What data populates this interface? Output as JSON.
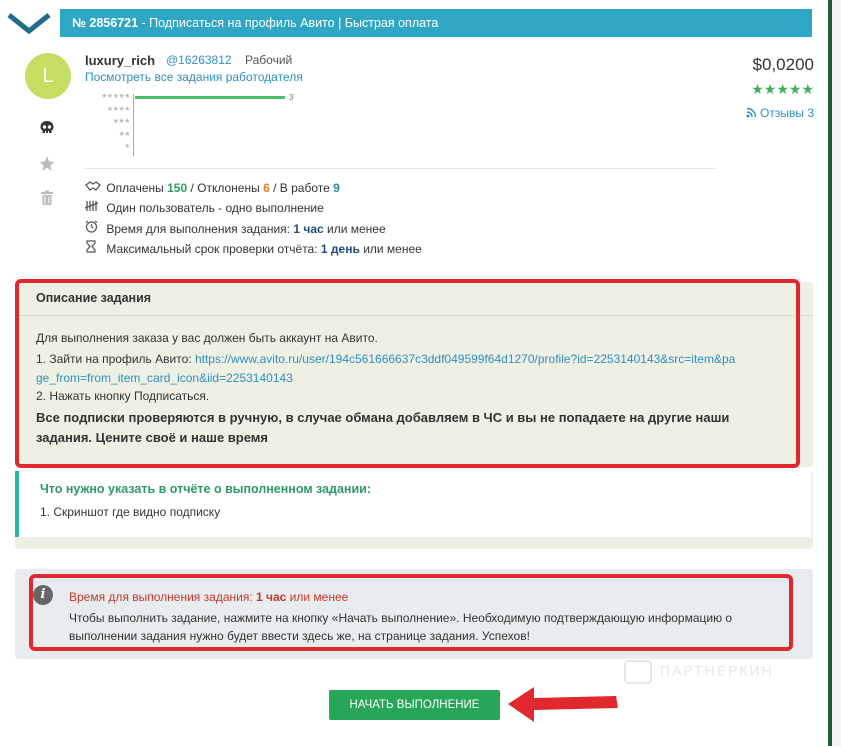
{
  "header": {
    "task_number": "№ 2856721",
    "title": " - Подписаться на профиль Авито | Быстрая оплата"
  },
  "employer": {
    "avatar_letter": "L",
    "avatar_color": "#c5df63",
    "name": "luxury_rich",
    "id": "@16263812",
    "status": "Рабочий",
    "view_tasks_link": "Посмотреть все задания работодателя",
    "side_icons": [
      "skull-icon",
      "star-icon",
      "trash-icon"
    ],
    "rating_distribution": [
      {
        "stars": "★★★★★",
        "count": 3,
        "count_label": "3"
      },
      {
        "stars": "★★★★",
        "count": 0
      },
      {
        "stars": "★★★",
        "count": 0
      },
      {
        "stars": "★★",
        "count": 0
      },
      {
        "stars": "★",
        "count": 0
      }
    ]
  },
  "price": {
    "amount": "$0,0200",
    "stars": "★★★★★",
    "reviews_label": "Отзывы 3",
    "accent": "#3cb05a"
  },
  "stats": {
    "paid_label": "Оплачены",
    "paid": "150",
    "sep1": " / ",
    "rejected_label": "Отклонены",
    "rejected": "6",
    "sep2": " / ",
    "in_work_label": "В работе",
    "in_work": "9",
    "one_user": "Один пользователь - одно выполнение",
    "time_label": "Время для выполнения задания:",
    "time_value": "1 час",
    "time_suffix": "или менее",
    "check_label": "Максимальный срок проверки отчёта:",
    "check_value": "1 день",
    "check_suffix": "или менее"
  },
  "description": {
    "title": "Описание задания",
    "line1": "Для выполнения заказа у вас должен быть аккаунт на Авито.",
    "step1_prefix": "1. Зайти на профиль Авито: ",
    "step1_link_a": "https://www.avito.ru/user/194c561666637c3ddf049599f64d1270/profile?id=2253140143&src=item&pa",
    "step1_link_b": "ge_from=from_item_card_icon&iid=2253140143",
    "step2": "2. Нажать кнопку Подписаться.",
    "warning_a": "Все подписки проверяются в ручную, в случае обмана добавляем в ЧС и вы не попадаете на другие наши",
    "warning_b": "задания. Цените своё и наше время"
  },
  "report": {
    "title": "Что нужно указать в отчёте о выполненном задании:",
    "item1": "1. Скриншот где видно подписку"
  },
  "notice": {
    "time_label": "Время для выполнения задания:",
    "time_value": "1 час",
    "time_suffix": "или менее",
    "line1": "Чтобы выполнить задание, нажмите на кнопку «Начать выполнение». Необходимую подтверждающую информацию о",
    "line2": "выполнении задания нужно будет ввести здесь же, на странице задания. Успехов!"
  },
  "watermark": "ПАРТНЕРКИН",
  "start_button": "НАЧАТЬ ВЫПОЛНЕНИЕ",
  "colors": {
    "header": "#2fa7c4",
    "highlight": "#e0282e",
    "button": "#27a658"
  }
}
